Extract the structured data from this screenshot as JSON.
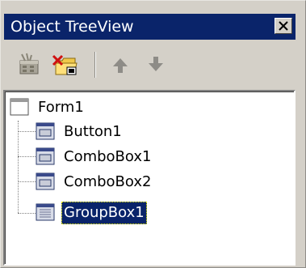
{
  "window": {
    "title": "Object TreeView"
  },
  "toolbar": {
    "buttons": [
      {
        "name": "new-object-button",
        "icon": "toolbox-icon"
      },
      {
        "name": "delete-object-button",
        "icon": "folder-delete-icon"
      },
      {
        "name": "move-up-button",
        "icon": "arrow-up-icon"
      },
      {
        "name": "move-down-button",
        "icon": "arrow-down-icon"
      }
    ]
  },
  "tree": {
    "root": {
      "label": "Form1",
      "icon": "form-icon"
    },
    "children": [
      {
        "label": "Button1",
        "icon": "button-control-icon"
      },
      {
        "label": "ComboBox1",
        "icon": "combobox-control-icon"
      },
      {
        "label": "ComboBox2",
        "icon": "combobox-control-icon"
      },
      {
        "label": "GroupBox1",
        "icon": "groupbox-control-icon",
        "selected": true
      }
    ]
  },
  "colors": {
    "titlebar": "#0a246a",
    "face": "#d4d0c8",
    "selection": "#0a246a"
  }
}
